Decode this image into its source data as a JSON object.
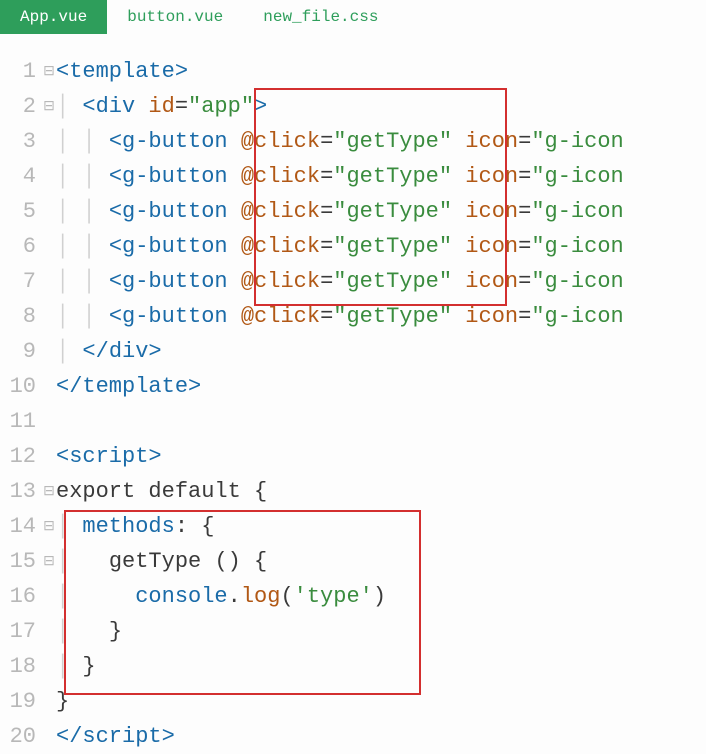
{
  "tabs": [
    {
      "label": "App.vue",
      "active": true
    },
    {
      "label": "button.vue",
      "active": false
    },
    {
      "label": "new_file.css",
      "active": false
    }
  ],
  "code": {
    "l1": {
      "num": "1",
      "fold": "⊟",
      "tag": "template"
    },
    "l2": {
      "num": "2",
      "fold": "⊟",
      "tag": "div",
      "attr": "id",
      "val": "\"app\""
    },
    "l3": {
      "num": "3",
      "tag": "g-button",
      "ev": "@click",
      "evval": "\"getType\"",
      "attr2": "icon",
      "val2": "\"g-icon"
    },
    "l4": {
      "num": "4",
      "tag": "g-button",
      "ev": "@click",
      "evval": "\"getType\"",
      "attr2": "icon",
      "val2": "\"g-icon"
    },
    "l5": {
      "num": "5",
      "tag": "g-button",
      "ev": "@click",
      "evval": "\"getType\"",
      "attr2": "icon",
      "val2": "\"g-icon"
    },
    "l6": {
      "num": "6",
      "tag": "g-button",
      "ev": "@click",
      "evval": "\"getType\"",
      "attr2": "icon",
      "val2": "\"g-icon"
    },
    "l7": {
      "num": "7",
      "tag": "g-button",
      "ev": "@click",
      "evval": "\"getType\"",
      "attr2": "icon",
      "val2": "\"g-icon"
    },
    "l8": {
      "num": "8",
      "tag": "g-button",
      "ev": "@click",
      "evval": "\"getType\"",
      "attr2": "icon",
      "val2": "\"g-icon"
    },
    "l9": {
      "num": "9",
      "close": "div"
    },
    "l10": {
      "num": "10",
      "close": "template"
    },
    "l11": {
      "num": "11"
    },
    "l12": {
      "num": "12",
      "tag": "script"
    },
    "l13": {
      "num": "13",
      "fold": "⊟",
      "kw1": "export",
      "kw2": "default",
      "brace": "{"
    },
    "l14": {
      "num": "14",
      "fold": "⊟",
      "prop": "methods",
      "colon": ":",
      "brace": "{"
    },
    "l15": {
      "num": "15",
      "fold": "⊟",
      "fn": "getType",
      "parens": "()",
      "brace": "{"
    },
    "l16": {
      "num": "16",
      "obj": "console",
      "dot": ".",
      "meth": "log",
      "paren1": "(",
      "str": "'type'",
      "paren2": ")"
    },
    "l17": {
      "num": "17",
      "brace": "}"
    },
    "l18": {
      "num": "18",
      "brace": "}"
    },
    "l19": {
      "num": "19",
      "brace": "}"
    },
    "l20": {
      "num": "20",
      "close": "script"
    }
  }
}
